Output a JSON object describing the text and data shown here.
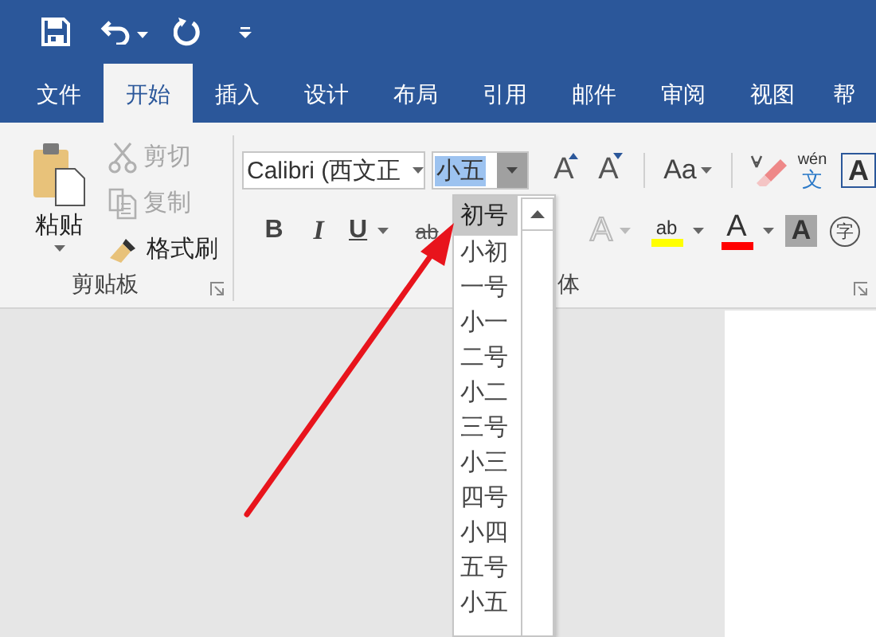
{
  "tabs": [
    {
      "label": "文件",
      "selected": false
    },
    {
      "label": "开始",
      "selected": true
    },
    {
      "label": "插入",
      "selected": false
    },
    {
      "label": "设计",
      "selected": false
    },
    {
      "label": "布局",
      "selected": false
    },
    {
      "label": "引用",
      "selected": false
    },
    {
      "label": "邮件",
      "selected": false
    },
    {
      "label": "审阅",
      "selected": false
    },
    {
      "label": "视图",
      "selected": false
    },
    {
      "label": "帮",
      "selected": false
    }
  ],
  "clipboard": {
    "paste": "粘贴",
    "items": [
      {
        "kind": "cut",
        "label": "剪切",
        "disabled": true
      },
      {
        "kind": "copy",
        "label": "复制",
        "disabled": true
      },
      {
        "kind": "painter",
        "label": "格式刷",
        "disabled": false
      }
    ],
    "group_label": "剪贴板"
  },
  "font": {
    "font_name": "Calibri (西文正",
    "font_size": "小五",
    "group_label": "体",
    "row1": [
      {
        "kind": "grow",
        "glyph": "A"
      },
      {
        "kind": "shrink",
        "glyph": "A"
      },
      {
        "kind": "case",
        "glyph": "Aa"
      },
      {
        "kind": "eraser"
      },
      {
        "kind": "phonetic",
        "ruby": "wén",
        "glyph": "文"
      },
      {
        "kind": "border",
        "glyph": "A"
      }
    ],
    "row2": [
      {
        "kind": "bold",
        "glyph": "B"
      },
      {
        "kind": "italic",
        "glyph": "I"
      },
      {
        "kind": "underline",
        "glyph": "U"
      },
      {
        "kind": "strike",
        "glyph": "ab"
      },
      {
        "kind": "effect",
        "glyph": "A"
      },
      {
        "kind": "highlight",
        "glyph": "ab",
        "color": "#ffff00"
      },
      {
        "kind": "fontcolor",
        "glyph": "A",
        "color": "#ff0000"
      },
      {
        "kind": "shading",
        "glyph": "A"
      },
      {
        "kind": "enclose",
        "glyph": "字"
      }
    ]
  },
  "size_list": [
    {
      "label": "初号",
      "selected": true
    },
    {
      "label": "小初",
      "selected": false
    },
    {
      "label": "一号",
      "selected": false
    },
    {
      "label": "小一",
      "selected": false
    },
    {
      "label": "二号",
      "selected": false
    },
    {
      "label": "小二",
      "selected": false
    },
    {
      "label": "三号",
      "selected": false
    },
    {
      "label": "小三",
      "selected": false
    },
    {
      "label": "四号",
      "selected": false
    },
    {
      "label": "小四",
      "selected": false
    },
    {
      "label": "五号",
      "selected": false
    },
    {
      "label": "小五",
      "selected": false
    }
  ]
}
